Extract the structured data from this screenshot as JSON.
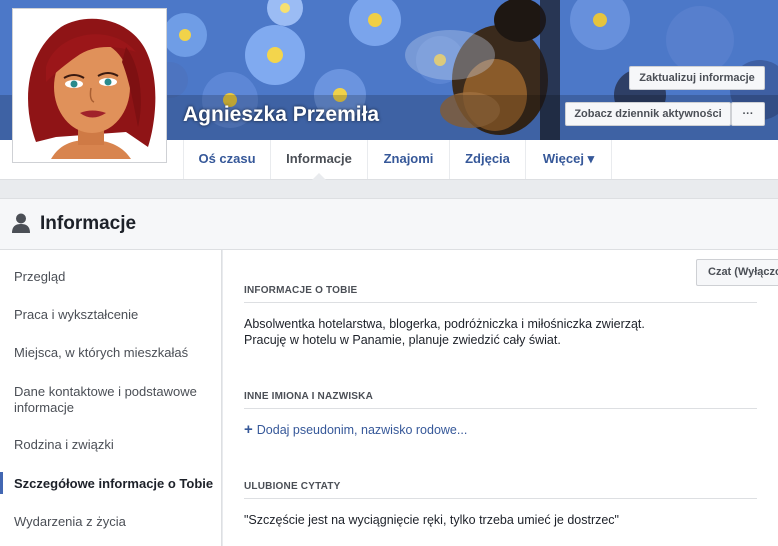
{
  "profile": {
    "name": "Agnieszka Przemiła",
    "update_info_label": "Zaktualizuj informacje",
    "activity_log_label": "Zobacz dziennik aktywności",
    "more_label": "···"
  },
  "nav": {
    "tabs": [
      {
        "label": "Oś czasu"
      },
      {
        "label": "Informacje"
      },
      {
        "label": "Znajomi"
      },
      {
        "label": "Zdjęcia"
      },
      {
        "label": "Więcej ▾"
      }
    ],
    "active_tab": "Informacje"
  },
  "section": {
    "title": "Informacje",
    "icon": "person-icon"
  },
  "sidebar": {
    "items": [
      {
        "label": "Przegląd"
      },
      {
        "label": "Praca i wykształcenie"
      },
      {
        "label": "Miejsca, w których mieszkałaś"
      },
      {
        "label": "Dane kontaktowe i podstawowe informacje"
      },
      {
        "label": "Rodzina i związki"
      },
      {
        "label": "Szczegółowe informacje o Tobie"
      },
      {
        "label": "Wydarzenia z życia"
      }
    ],
    "active_item": "Szczegółowe informacje o Tobie"
  },
  "content": {
    "about": {
      "title": "INFORMACJE O TOBIE",
      "line1": "Absolwentka hotelarstwa, blogerka, podróżniczka i miłośniczka zwierząt.",
      "line2": "Pracuję w hotelu w Panamie, planuje zwiedzić cały świat."
    },
    "other_names": {
      "title": "INNE IMIONA I NAZWISKA",
      "add_label": "Dodaj pseudonim, nazwisko rodowe..."
    },
    "quotes": {
      "title": "ULUBIONE CYTATY",
      "text": "\"Szczęście jest na wyciągnięcie ręki, tylko trzeba umieć je dostrzec\""
    }
  },
  "chat": {
    "label": "Czat (Wyłączony)"
  },
  "colors": {
    "link": "#365899",
    "accent": "#4267b2",
    "background": "#e9ebee"
  }
}
